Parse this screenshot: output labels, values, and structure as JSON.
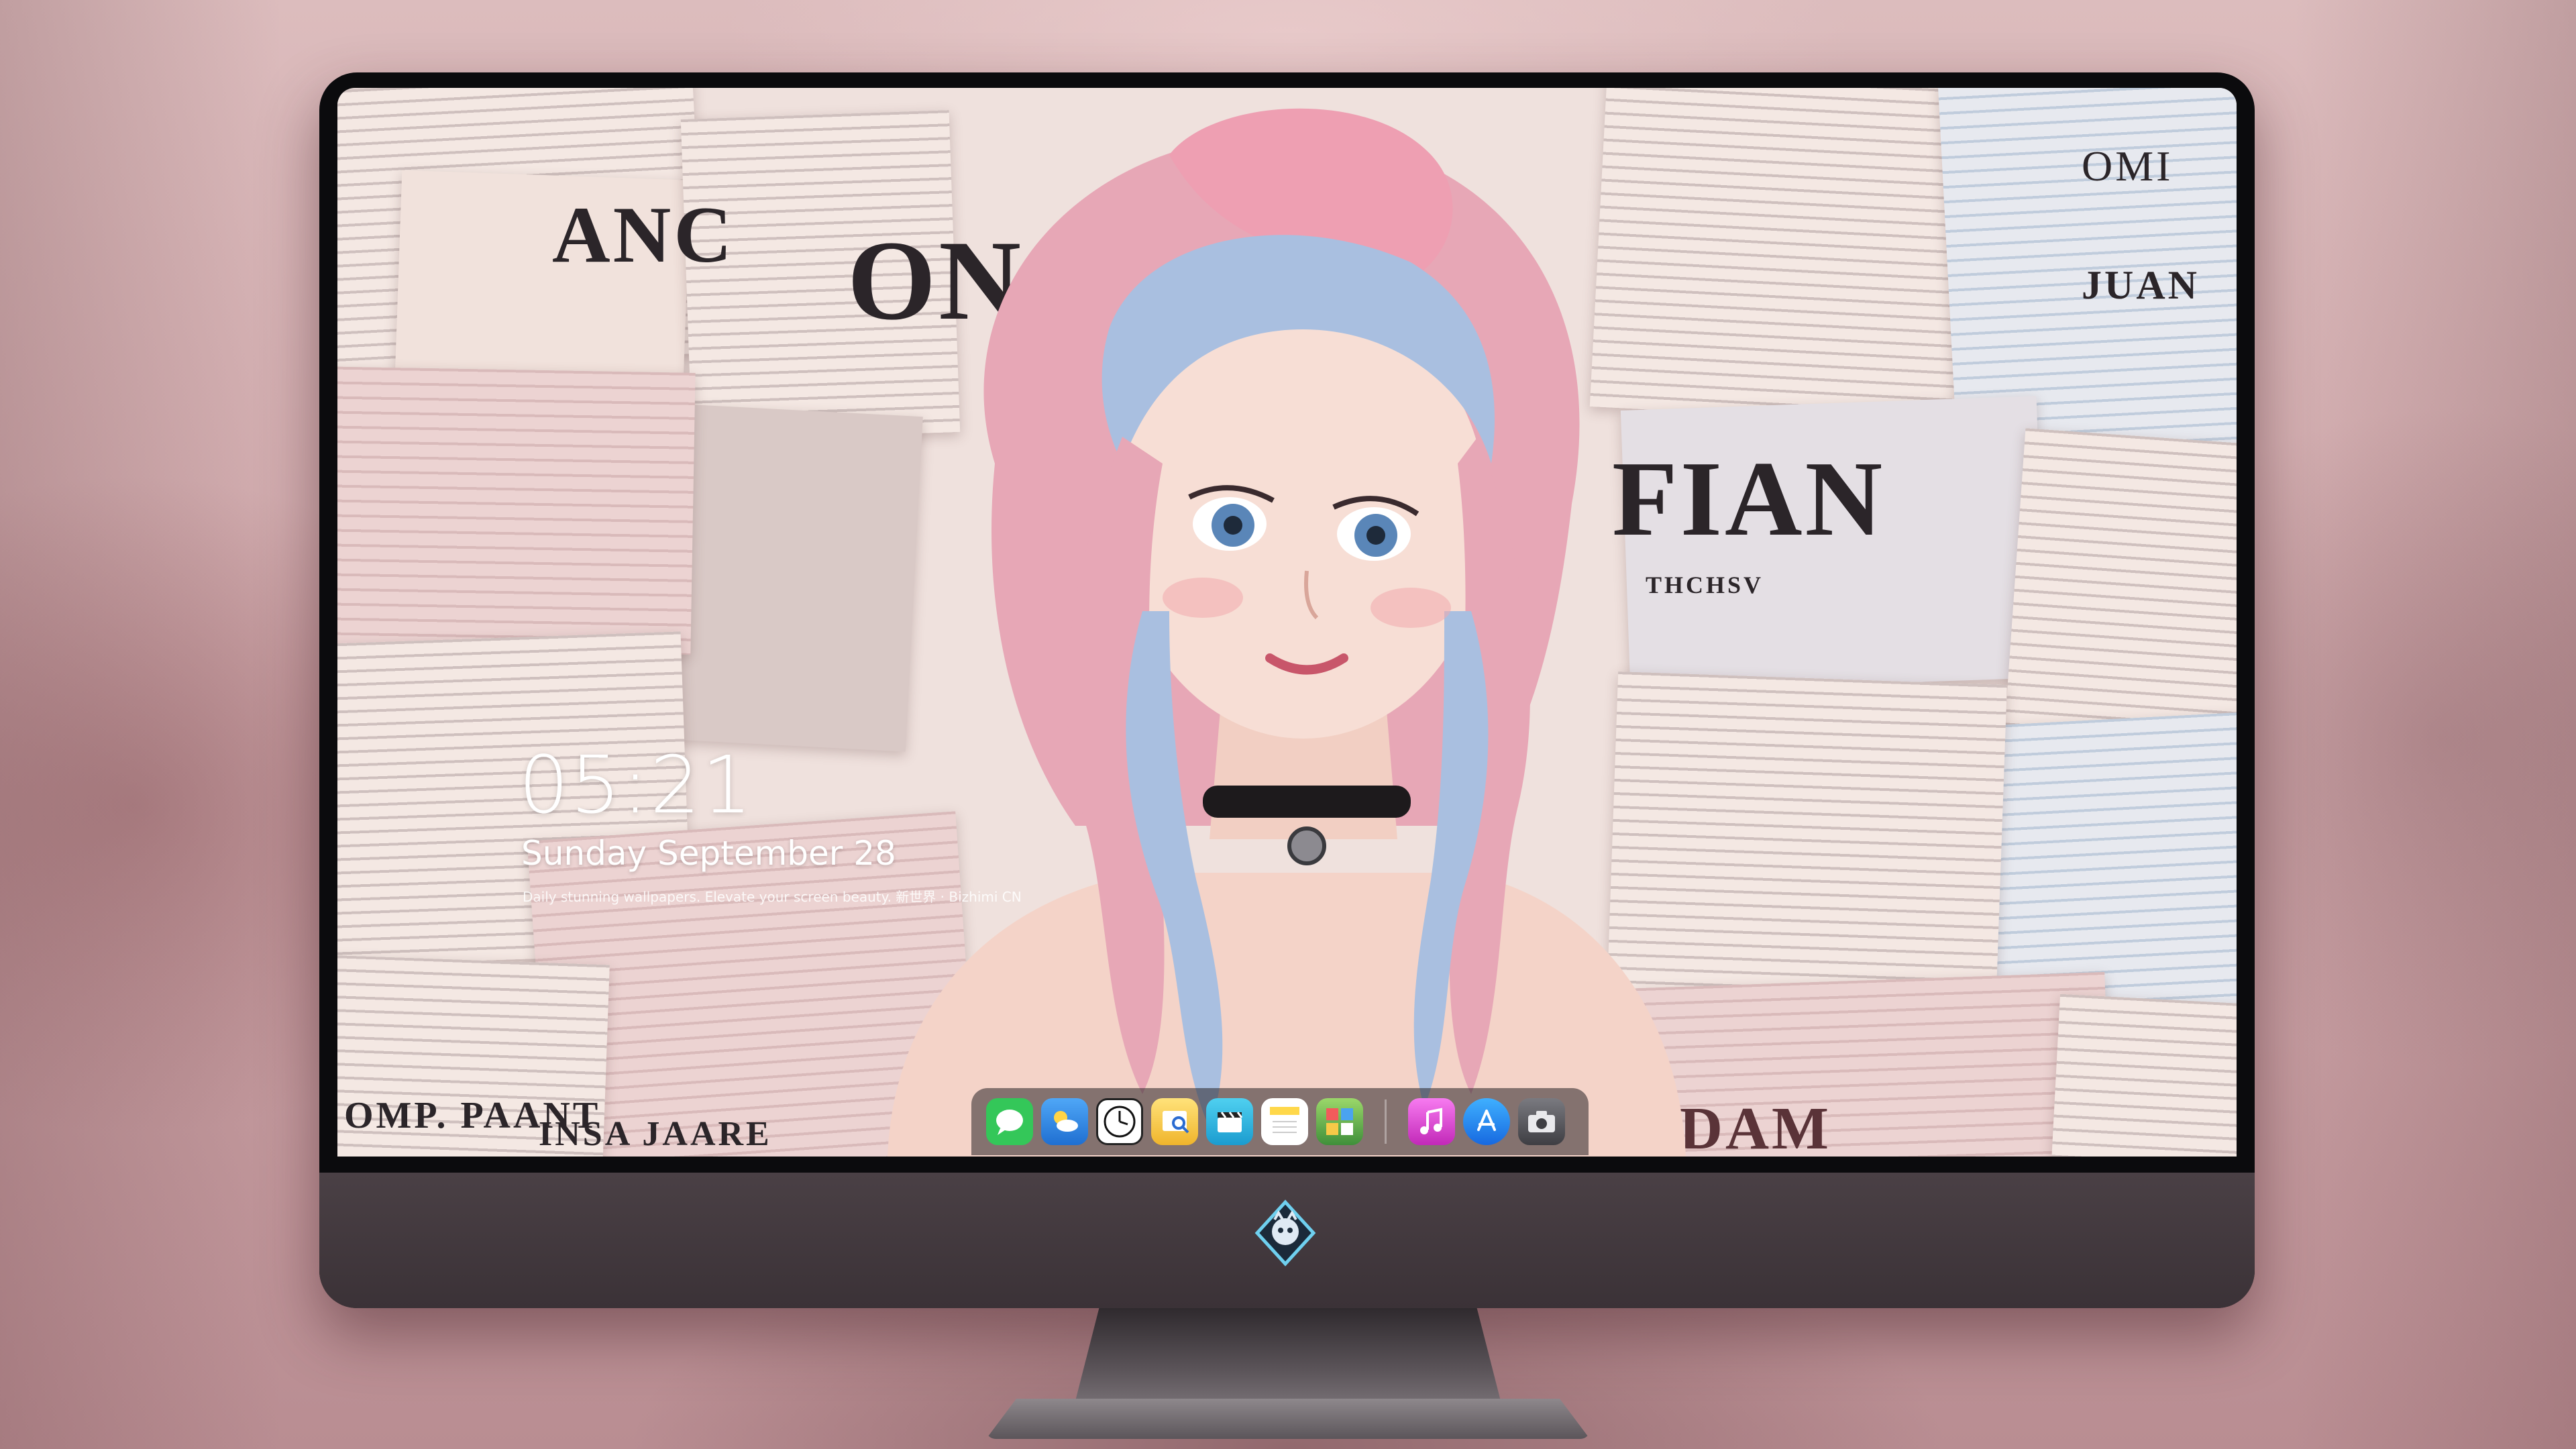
{
  "lockscreen": {
    "time": "05:21",
    "date": "Sunday September  28",
    "tagline": "Daily stunning wallpapers. Elevate your screen beauty. 新世界 · Bizhimi CN"
  },
  "dock": {
    "apps": [
      {
        "name": "Messages",
        "icon": "messages-icon",
        "color": "#34c759"
      },
      {
        "name": "Weather",
        "icon": "weather-icon",
        "color": "#3a8ee6"
      },
      {
        "name": "Clock",
        "icon": "clock-icon",
        "color": "#ffffff"
      },
      {
        "name": "Preview",
        "icon": "preview-icon",
        "color": "#f4c542"
      },
      {
        "name": "Clips",
        "icon": "clips-icon",
        "color": "#28b7e0"
      },
      {
        "name": "Notes",
        "icon": "notes-icon",
        "color": "#ffd84a"
      },
      {
        "name": "Photo Booth",
        "icon": "photo-booth-icon",
        "color": "#5aa04a"
      },
      {
        "name": "Music",
        "icon": "music-icon",
        "color": "#e03ad9"
      },
      {
        "name": "App Store",
        "icon": "app-store-icon",
        "color": "#1f8ef1"
      },
      {
        "name": "Screenshot",
        "icon": "camera-icon",
        "color": "#5c5c60"
      }
    ]
  },
  "wallpaper": {
    "headlines": [
      "ANC",
      "ON",
      "FIAN",
      "THCHSV",
      "JUAN",
      "OMI",
      "OMP. PAANT",
      "INSA JAARE",
      "DAM"
    ]
  },
  "colors": {
    "monitor_frame": "#0b0b0d",
    "chin": "#3f363b",
    "hair_pink": "#e7a7b6",
    "hair_blue": "#a9bfe0"
  }
}
